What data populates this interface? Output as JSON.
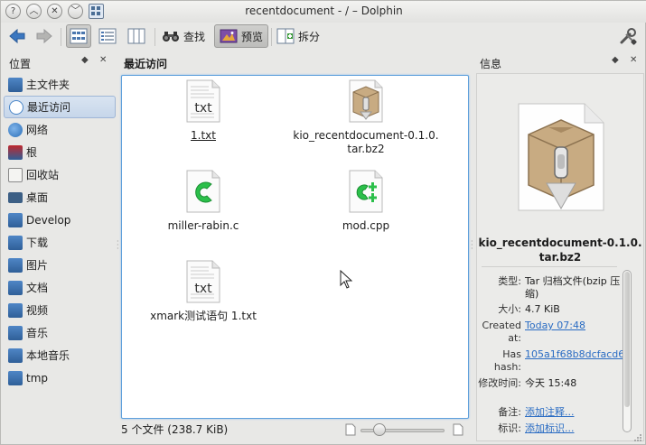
{
  "window": {
    "title": "recentdocument - / – Dolphin"
  },
  "toolbar": {
    "find_label": "查找",
    "preview_label": "预览",
    "split_label": "拆分"
  },
  "places": {
    "title": "位置",
    "items": [
      {
        "label": "主文件夹",
        "icon": "home-folder-icon",
        "color": "#4f86c6"
      },
      {
        "label": "最近访问",
        "icon": "recent-icon",
        "color": "#4a86c8"
      },
      {
        "label": "网络",
        "icon": "network-icon",
        "color": "#2c6fb8"
      },
      {
        "label": "根",
        "icon": "root-icon",
        "color": "#c0282d"
      },
      {
        "label": "回收站",
        "icon": "trash-icon",
        "color": "#8a8a8a"
      },
      {
        "label": "桌面",
        "icon": "desktop-icon",
        "color": "#3c5f85"
      },
      {
        "label": "Develop",
        "icon": "folder-icon",
        "color": "#4f86c6"
      },
      {
        "label": "下载",
        "icon": "download-folder-icon",
        "color": "#4f86c6"
      },
      {
        "label": "图片",
        "icon": "pictures-folder-icon",
        "color": "#4f86c6"
      },
      {
        "label": "文档",
        "icon": "documents-folder-icon",
        "color": "#4f86c6"
      },
      {
        "label": "视频",
        "icon": "videos-folder-icon",
        "color": "#4f86c6"
      },
      {
        "label": "音乐",
        "icon": "music-folder-icon",
        "color": "#4f86c6"
      },
      {
        "label": "本地音乐",
        "icon": "local-music-folder-icon",
        "color": "#4f86c6"
      },
      {
        "label": "tmp",
        "icon": "folder-icon",
        "color": "#4f86c6"
      }
    ]
  },
  "content": {
    "title": "最近访问",
    "files": [
      {
        "name": "1.txt",
        "icon_text": "txt",
        "icon": "text-file-icon"
      },
      {
        "name_line1": "kio_recentdocument-0.1.0.",
        "name_line2": "tar.bz2",
        "icon": "archive-file-icon"
      },
      {
        "name": "miller-rabin.c",
        "icon": "c-source-file-icon"
      },
      {
        "name": "mod.cpp",
        "icon": "cpp-source-file-icon"
      },
      {
        "name": "xmark测试语句 1.txt",
        "icon_text": "txt",
        "icon": "text-file-icon"
      }
    ]
  },
  "status": {
    "summary": "5 个文件 (238.7 KiB)"
  },
  "info": {
    "title": "信息",
    "filename_line1": "kio_recentdocument-0.1.0.",
    "filename_line2": "tar.bz2",
    "type_label": "类型:",
    "type_value": "Tar 归档文件(bzip 压缩)",
    "size_label": "大小:",
    "size_value": "4.7 KiB",
    "created_label": "Created at:",
    "created_value": "Today 07:48",
    "hash_label": "Has hash:",
    "hash_value": "105a1f68b8dcfacd6a",
    "modified_label": "修改时间:",
    "modified_value": "今天 15:48",
    "comment_label": "备注:",
    "comment_value": "添加注释...",
    "tags_label": "标识:",
    "tags_value": "添加标识..."
  }
}
